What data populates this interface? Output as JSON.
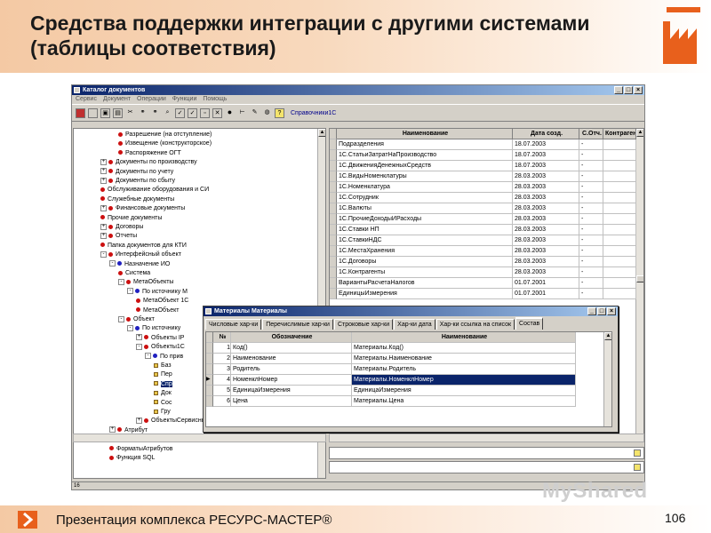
{
  "slide": {
    "title": "Средства поддержки интеграции с другими системами (таблицы соответствия)",
    "footer": "Презентация комплекса РЕСУРС-МАСТЕР®",
    "page_number": "106",
    "watermark": "MyShared",
    "accent_color": "#e8601c"
  },
  "window": {
    "title": "Каталог документов",
    "menu": [
      "Сервис",
      "Документ",
      "Операции",
      "Функции",
      "Помощь"
    ],
    "toolbar_link": "Справочники1С",
    "controls": [
      "_",
      "□",
      "×"
    ]
  },
  "tree": {
    "items": [
      {
        "label": "Разрешение (на отступление)",
        "level": 3,
        "bullet": "red"
      },
      {
        "label": "Извещение (конструкторское)",
        "level": 3,
        "bullet": "red"
      },
      {
        "label": "Распоряжение ОГТ",
        "level": 3,
        "bullet": "red"
      },
      {
        "label": "Документы по производству",
        "level": 1,
        "bullet": "red",
        "exp": "+"
      },
      {
        "label": "Документы по учету",
        "level": 1,
        "bullet": "red",
        "exp": "+"
      },
      {
        "label": "Документы по сбыту",
        "level": 1,
        "bullet": "red",
        "exp": "+"
      },
      {
        "label": "Обслуживание оборудования и СИ",
        "level": 1,
        "bullet": "red"
      },
      {
        "label": "Служебные документы",
        "level": 1,
        "bullet": "red"
      },
      {
        "label": "Финансовые документы",
        "level": 1,
        "bullet": "red",
        "exp": "+"
      },
      {
        "label": "Прочие документы",
        "level": 1,
        "bullet": "red"
      },
      {
        "label": "Договоры",
        "level": 1,
        "bullet": "red",
        "exp": "+"
      },
      {
        "label": "Отчеты",
        "level": 1,
        "bullet": "red",
        "exp": "+"
      },
      {
        "label": "Папка документов для КТИ",
        "level": 1,
        "bullet": "red"
      },
      {
        "label": "Интерфейсный объект",
        "level": 1,
        "bullet": "red",
        "exp": "-"
      },
      {
        "label": "Назначение ИО",
        "level": 2,
        "bullet": "blue",
        "exp": "-"
      },
      {
        "label": "Система",
        "level": 3,
        "bullet": "red"
      },
      {
        "label": "МетаОбъекты",
        "level": 3,
        "bullet": "red",
        "exp": "-"
      },
      {
        "label": "По источнику М",
        "level": 4,
        "bullet": "blue",
        "exp": "-"
      },
      {
        "label": "МетаОбъект 1С",
        "level": 5,
        "bullet": "red"
      },
      {
        "label": "МетаОбъект",
        "level": 5,
        "bullet": "red"
      },
      {
        "label": "Объект",
        "level": 3,
        "bullet": "red",
        "exp": "-"
      },
      {
        "label": "По источнику",
        "level": 4,
        "bullet": "blue",
        "exp": "-"
      },
      {
        "label": "Объекты IP",
        "level": 5,
        "bullet": "red",
        "exp": "+"
      },
      {
        "label": "Объекты1С",
        "level": 5,
        "bullet": "red",
        "exp": "-"
      },
      {
        "label": "По прив",
        "level": 6,
        "bullet": "blue",
        "exp": "-"
      },
      {
        "label": "Баз",
        "level": 7,
        "bullet": "none"
      },
      {
        "label": "Пер",
        "level": 7,
        "bullet": "none"
      },
      {
        "label": "Спр",
        "level": 7,
        "bullet": "none",
        "selected": true
      },
      {
        "label": "Док",
        "level": 7,
        "bullet": "none"
      },
      {
        "label": "Сос",
        "level": 7,
        "bullet": "none"
      },
      {
        "label": "Гру",
        "level": 7,
        "bullet": "none"
      },
      {
        "label": "ОбъектыСервисные",
        "level": 5,
        "bullet": "red",
        "exp": "+"
      },
      {
        "label": "Атрибут",
        "level": 2,
        "bullet": "red",
        "exp": "+"
      },
      {
        "label": "ТипыАтрибутов",
        "level": 2,
        "bullet": "red"
      },
      {
        "label": "ФорматыАтрибутов",
        "level": 2,
        "bullet": "red"
      },
      {
        "label": "Функция SQL",
        "level": 2,
        "bullet": "red"
      }
    ]
  },
  "grid": {
    "headers": [
      "Наименование",
      "Дата созд.",
      "С.Отч.",
      "Контрагент"
    ],
    "rows": [
      [
        "Подразделения",
        "18.07.2003",
        "-"
      ],
      [
        "1С.СтатьиЗатратНаПроизводство",
        "18.07.2003",
        "-"
      ],
      [
        "1С.ДвиженияДенежныхСредств",
        "18.07.2003",
        "-"
      ],
      [
        "1С.ВидыНоменклатуры",
        "28.03.2003",
        "-"
      ],
      [
        "1С.Номенклатура",
        "28.03.2003",
        "-"
      ],
      [
        "1С.Сотрудник",
        "28.03.2003",
        "-"
      ],
      [
        "1С.Валюты",
        "28.03.2003",
        "-"
      ],
      [
        "1С.ПрочиеДоходыИРасходы",
        "28.03.2003",
        "-"
      ],
      [
        "1С.Ставки НП",
        "28.03.2003",
        "-"
      ],
      [
        "1С.СтавкиНДС",
        "28.03.2003",
        "-"
      ],
      [
        "1С.МестаХранения",
        "28.03.2003",
        "-"
      ],
      [
        "1С.Договоры",
        "28.03.2003",
        "-"
      ],
      [
        "1С.Контрагенты",
        "28.03.2003",
        "-"
      ],
      [
        "ВариантыРасчетаНалогов",
        "01.07.2001",
        "-"
      ],
      [
        "ЕдиницыИзмерения",
        "01.07.2001",
        "-"
      ]
    ]
  },
  "dialog": {
    "title": "Материалы Материалы",
    "tabs": [
      "Числовые хар-ки",
      "Перечислимые хар-ки",
      "Строковые хар-ки",
      "Хар-ки дата",
      "Хар-ки ссылка на список",
      "Состав"
    ],
    "active_tab": 5,
    "headers": [
      "№",
      "Обозначение",
      "Наименование"
    ],
    "rows": [
      [
        "1",
        "Код()",
        "Материалы.Код()"
      ],
      [
        "2",
        "Наименование",
        "Материалы.Наименование"
      ],
      [
        "3",
        "Родитель",
        "Материалы.Родитель"
      ],
      [
        "4",
        "НоменклНомер",
        "Материалы.НоменклНомер"
      ],
      [
        "5",
        "ЕдиницаИзмерения",
        "ЕдиницаИзмерения"
      ],
      [
        "6",
        "Цена",
        "Материалы.Цена"
      ]
    ],
    "selected_row": 3
  },
  "status": {
    "left": "16"
  }
}
